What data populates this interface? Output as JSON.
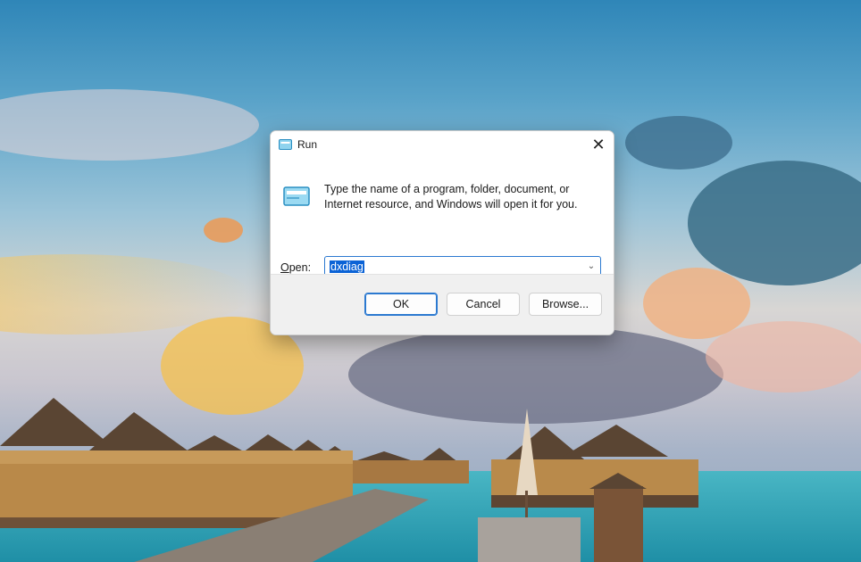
{
  "dialog": {
    "title": "Run",
    "close_glyph": "✕",
    "description": "Type the name of a program, folder, document, or Internet resource, and Windows will open it for you.",
    "open_label_accel": "O",
    "open_label_rest": "pen:",
    "combo_value": "dxdiag",
    "buttons": {
      "ok": "OK",
      "cancel": "Cancel",
      "browse": "Browse..."
    }
  },
  "icons": {
    "title": "run-icon",
    "body": "run-icon",
    "close": "close-icon",
    "dropdown": "chevron-down-icon"
  },
  "colors": {
    "accent": "#2b79d0",
    "selection": "#0b63d6",
    "footer_bg": "#f0f0f0"
  }
}
